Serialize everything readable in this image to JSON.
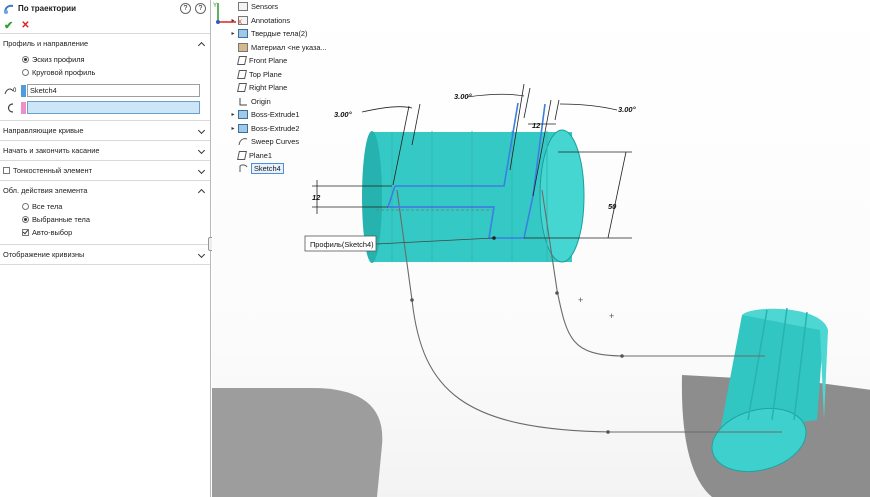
{
  "property_manager": {
    "title": "По траектории",
    "profile_section": {
      "title": "Профиль и направление",
      "options": [
        {
          "label": "Эскиз профиля",
          "selected": true
        },
        {
          "label": "Круговой профиль",
          "selected": false
        }
      ],
      "profile_value": "Sketch4",
      "profile_prefix": "0",
      "path_value": ""
    },
    "collapsed_sections": [
      "Направляющие кривые",
      "Начать и закончить касание",
      "Тонкостенный элемент"
    ],
    "scope_section": {
      "title": "Обл. действия элемента",
      "options": [
        {
          "label": "Все тела",
          "selected": false
        },
        {
          "label": "Выбранные тела",
          "selected": true
        }
      ],
      "auto_select": {
        "label": "Авто-выбор",
        "checked": true
      }
    },
    "curvature_section": "Отображение кривизны"
  },
  "feature_tree": [
    {
      "label": "Sensors",
      "expand": "",
      "icon": "sensor-icon"
    },
    {
      "label": "Annotations",
      "expand": "▸",
      "icon": "annotation-icon"
    },
    {
      "label": "Твердые тела(2)",
      "expand": "▸",
      "icon": "solid-bodies-icon"
    },
    {
      "label": "Материал <не указа...",
      "expand": "",
      "icon": "material-icon"
    },
    {
      "label": "Front Plane",
      "expand": "",
      "icon": "plane-icon"
    },
    {
      "label": "Top Plane",
      "expand": "",
      "icon": "plane-icon"
    },
    {
      "label": "Right Plane",
      "expand": "",
      "icon": "plane-icon"
    },
    {
      "label": "Origin",
      "expand": "",
      "icon": "origin-icon"
    },
    {
      "label": "Boss-Extrude1",
      "expand": "▸",
      "icon": "extrude-icon"
    },
    {
      "label": "Boss-Extrude2",
      "expand": "▸",
      "icon": "extrude-icon"
    },
    {
      "label": "Sweep Curves",
      "expand": "",
      "icon": "curve-icon"
    },
    {
      "label": "Plane1",
      "expand": "",
      "icon": "plane-icon"
    },
    {
      "label": "Sketch4",
      "expand": "",
      "icon": "sketch-icon"
    }
  ],
  "viewport": {
    "dimensions": {
      "angle_left": "3.00°",
      "angle_top": "3.00°",
      "angle_right": "3.00°",
      "width_12_top": "12",
      "width_12_left": "12",
      "height_50": "50"
    },
    "profile_callout": "Профиль(Sketch4)",
    "axis_labels": {
      "x": "X",
      "y": "Y"
    }
  },
  "colors": {
    "cylinder": "#35c9c5",
    "cylinder_dark": "#1aa8a5",
    "sketch_blue": "#3c7fe0",
    "ok_green": "#2ea12e",
    "cancel_red": "#dd2222"
  }
}
